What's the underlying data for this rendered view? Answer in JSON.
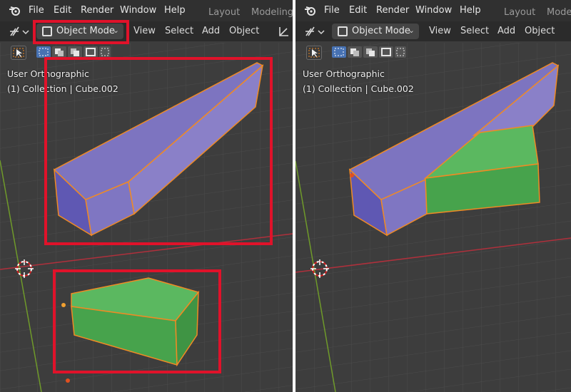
{
  "menubar": {
    "items": [
      "File",
      "Edit",
      "Render",
      "Window",
      "Help"
    ],
    "workspace_tabs_left": [
      "Layout",
      "Modeling"
    ],
    "workspace_tabs_right": [
      "Layout",
      "Model"
    ]
  },
  "header": {
    "mode_label": "Object Mode",
    "menu": [
      "View",
      "Select",
      "Add",
      "Object"
    ]
  },
  "viewport": {
    "view_name": "User Orthographic",
    "collection_info": "(1) Collection | Cube.002"
  },
  "colors": {
    "highlight": "#e0122a",
    "purple_face": "#7d74c0",
    "green_face": "#55b35a",
    "selection_outline": "#f08a24",
    "x_axis": "#b0303c",
    "y_axis": "#6f9a2a"
  },
  "icons": {
    "logo": "blender-logo-icon",
    "navigate": "navigate-gizmo-icon",
    "select_tool": "select-box-tool-icon",
    "mode": "object-mode-icon",
    "chevron": "chevron-down-icon",
    "transform": "transform-pivot-icon",
    "cursor3d": "3d-cursor-icon"
  }
}
